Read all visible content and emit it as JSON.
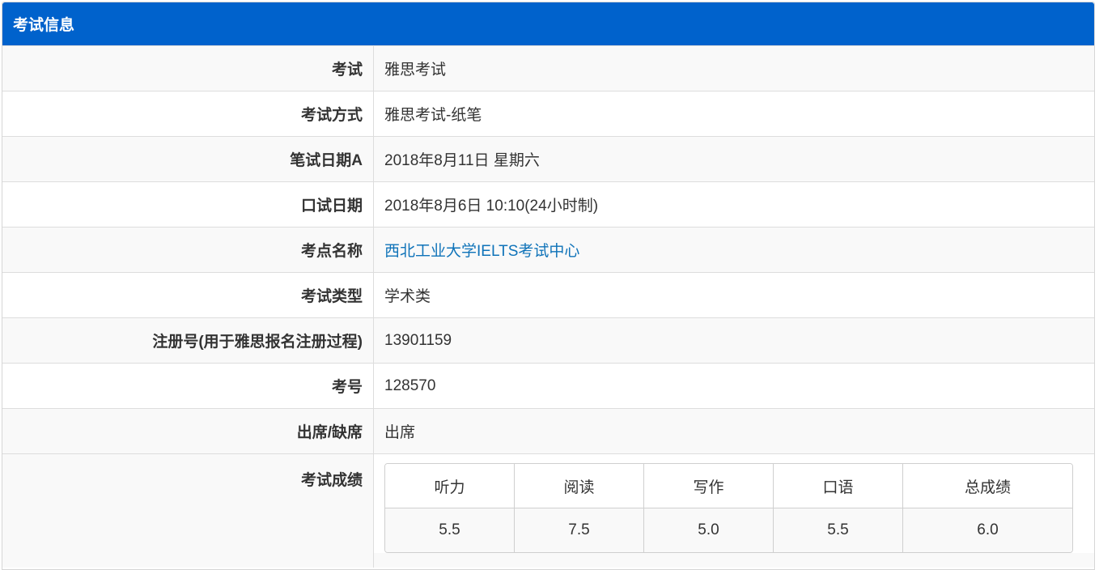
{
  "panel": {
    "title": "考试信息"
  },
  "rows": [
    {
      "label": "考试",
      "value": "雅思考试"
    },
    {
      "label": "考试方式",
      "value": "雅思考试-纸笔"
    },
    {
      "label": "笔试日期A",
      "value": "2018年8月11日 星期六"
    },
    {
      "label": "口试日期",
      "value": "2018年8月6日 10:10(24小时制)"
    },
    {
      "label": "考点名称",
      "value": "西北工业大学IELTS考试中心"
    },
    {
      "label": "考试类型",
      "value": "学术类"
    },
    {
      "label": "注册号(用于雅思报名注册过程)",
      "value": "13901159"
    },
    {
      "label": "考号",
      "value": "128570"
    },
    {
      "label": "出席/缺席",
      "value": "出席"
    }
  ],
  "scores": {
    "label": "考试成绩",
    "headers": [
      "听力",
      "阅读",
      "写作",
      "口语",
      "总成绩"
    ],
    "values": [
      "5.5",
      "7.5",
      "5.0",
      "5.5",
      "6.0"
    ]
  },
  "colors": {
    "header_bg": "#0062cc",
    "link": "#0f73b9"
  }
}
